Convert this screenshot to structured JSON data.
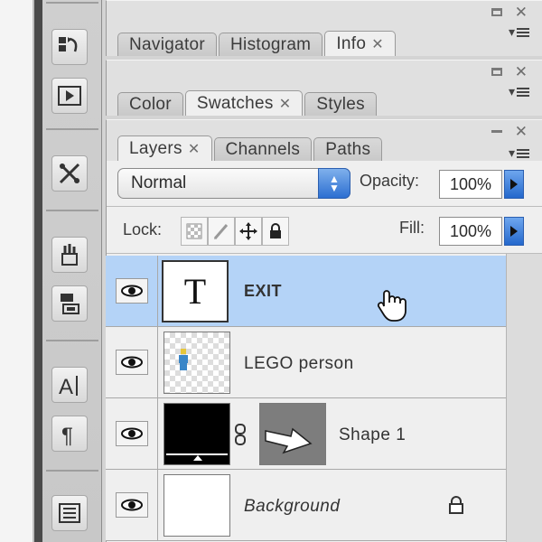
{
  "panel_group_1": {
    "tabs": [
      {
        "label": "Navigator",
        "active": false,
        "closable": false
      },
      {
        "label": "Histogram",
        "active": false,
        "closable": false
      },
      {
        "label": "Info",
        "active": true,
        "closable": true
      }
    ]
  },
  "panel_group_2": {
    "tabs": [
      {
        "label": "Color",
        "active": false,
        "closable": false
      },
      {
        "label": "Swatches",
        "active": true,
        "closable": true
      },
      {
        "label": "Styles",
        "active": false,
        "closable": false
      }
    ]
  },
  "layers_panel": {
    "tabs": [
      {
        "label": "Layers",
        "active": true,
        "closable": true
      },
      {
        "label": "Channels",
        "active": false,
        "closable": false
      },
      {
        "label": "Paths",
        "active": false,
        "closable": false
      }
    ],
    "blend_mode": "Normal",
    "opacity_label": "Opacity:",
    "opacity_value": "100%",
    "lock_label": "Lock:",
    "fill_label": "Fill:",
    "fill_value": "100%",
    "layers": [
      {
        "name": "EXIT",
        "type": "text",
        "thumb_text": "T",
        "selected": true,
        "visible": true
      },
      {
        "name": "LEGO person",
        "type": "image",
        "selected": false,
        "visible": true
      },
      {
        "name": "Shape 1",
        "type": "shape",
        "selected": false,
        "visible": true
      },
      {
        "name": "Background",
        "type": "background",
        "selected": false,
        "visible": true,
        "locked": true
      }
    ]
  },
  "colors": {
    "selection": "#b4d3f7",
    "accent_blue": "#2c6fd1"
  }
}
